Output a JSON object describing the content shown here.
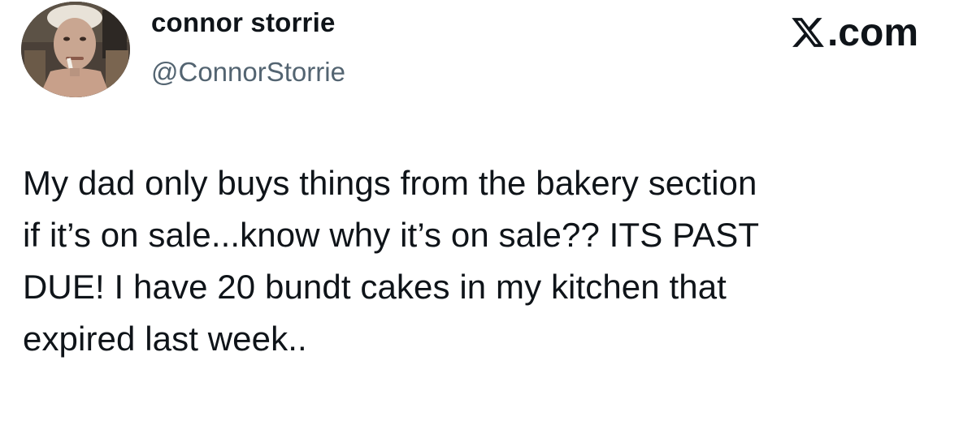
{
  "author": {
    "display_name": "connor storrie",
    "handle": "@ConnorStorrie",
    "avatar_icon": "profile-photo"
  },
  "brand": {
    "logo_icon": "x-logo-icon",
    "domain_suffix": ".com"
  },
  "tweet": {
    "lines": [
      "My dad only buys things from the bakery section",
      "if it’s on sale...know why it’s on sale?? ITS PAST",
      "DUE! I have 20 bundt cakes in my kitchen that",
      "expired last week.."
    ]
  },
  "colors": {
    "text": "#0f1419",
    "secondary_text": "#536471",
    "background": "#ffffff"
  }
}
